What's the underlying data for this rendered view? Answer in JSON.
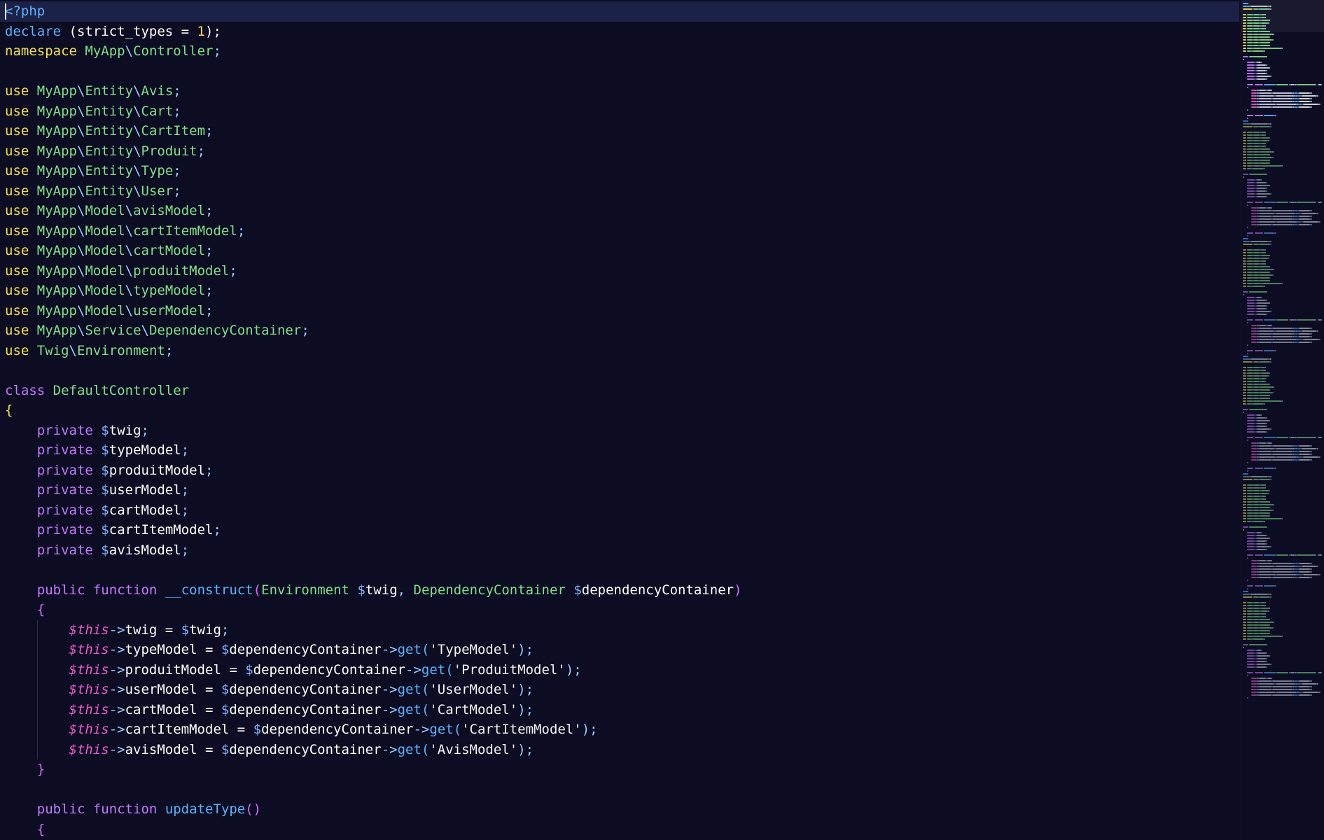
{
  "editor": {
    "current_line": 0,
    "colors": {
      "background": "#0c0c22",
      "current_line": "#1c2147",
      "keyword": "#f4e24a",
      "namespace": "#7fe08a",
      "modifier": "#c479ff",
      "variable": "#7fb2ff",
      "this": "#f05bcf",
      "function": "#5ab4ff"
    },
    "lines": [
      [
        {
          "t": "<?php",
          "c": "php"
        }
      ],
      [
        {
          "t": "declare",
          "c": "decl"
        },
        {
          "t": " (strict_types = ",
          "c": "name"
        },
        {
          "t": "1",
          "c": "num"
        },
        {
          "t": ");",
          "c": "name"
        }
      ],
      [
        {
          "t": "namespace",
          "c": "kw"
        },
        {
          "t": " ",
          "c": "name"
        },
        {
          "t": "MyApp",
          "c": "ns"
        },
        {
          "t": "\\",
          "c": "op"
        },
        {
          "t": "Controller",
          "c": "ns"
        },
        {
          "t": ";",
          "c": "op"
        }
      ],
      [],
      [
        {
          "t": "use",
          "c": "kw"
        },
        {
          "t": " ",
          "c": "name"
        },
        {
          "t": "MyApp",
          "c": "ns"
        },
        {
          "t": "\\",
          "c": "op"
        },
        {
          "t": "Entity",
          "c": "ns"
        },
        {
          "t": "\\",
          "c": "op"
        },
        {
          "t": "Avis",
          "c": "ns"
        },
        {
          "t": ";",
          "c": "op"
        }
      ],
      [
        {
          "t": "use",
          "c": "kw"
        },
        {
          "t": " ",
          "c": "name"
        },
        {
          "t": "MyApp",
          "c": "ns"
        },
        {
          "t": "\\",
          "c": "op"
        },
        {
          "t": "Entity",
          "c": "ns"
        },
        {
          "t": "\\",
          "c": "op"
        },
        {
          "t": "Cart",
          "c": "ns"
        },
        {
          "t": ";",
          "c": "op"
        }
      ],
      [
        {
          "t": "use",
          "c": "kw"
        },
        {
          "t": " ",
          "c": "name"
        },
        {
          "t": "MyApp",
          "c": "ns"
        },
        {
          "t": "\\",
          "c": "op"
        },
        {
          "t": "Entity",
          "c": "ns"
        },
        {
          "t": "\\",
          "c": "op"
        },
        {
          "t": "CartItem",
          "c": "ns"
        },
        {
          "t": ";",
          "c": "op"
        }
      ],
      [
        {
          "t": "use",
          "c": "kw"
        },
        {
          "t": " ",
          "c": "name"
        },
        {
          "t": "MyApp",
          "c": "ns"
        },
        {
          "t": "\\",
          "c": "op"
        },
        {
          "t": "Entity",
          "c": "ns"
        },
        {
          "t": "\\",
          "c": "op"
        },
        {
          "t": "Produit",
          "c": "ns"
        },
        {
          "t": ";",
          "c": "op"
        }
      ],
      [
        {
          "t": "use",
          "c": "kw"
        },
        {
          "t": " ",
          "c": "name"
        },
        {
          "t": "MyApp",
          "c": "ns"
        },
        {
          "t": "\\",
          "c": "op"
        },
        {
          "t": "Entity",
          "c": "ns"
        },
        {
          "t": "\\",
          "c": "op"
        },
        {
          "t": "Type",
          "c": "ns"
        },
        {
          "t": ";",
          "c": "op"
        }
      ],
      [
        {
          "t": "use",
          "c": "kw"
        },
        {
          "t": " ",
          "c": "name"
        },
        {
          "t": "MyApp",
          "c": "ns"
        },
        {
          "t": "\\",
          "c": "op"
        },
        {
          "t": "Entity",
          "c": "ns"
        },
        {
          "t": "\\",
          "c": "op"
        },
        {
          "t": "User",
          "c": "ns"
        },
        {
          "t": ";",
          "c": "op"
        }
      ],
      [
        {
          "t": "use",
          "c": "kw"
        },
        {
          "t": " ",
          "c": "name"
        },
        {
          "t": "MyApp",
          "c": "ns"
        },
        {
          "t": "\\",
          "c": "op"
        },
        {
          "t": "Model",
          "c": "ns"
        },
        {
          "t": "\\",
          "c": "op"
        },
        {
          "t": "avisModel",
          "c": "ns"
        },
        {
          "t": ";",
          "c": "op"
        }
      ],
      [
        {
          "t": "use",
          "c": "kw"
        },
        {
          "t": " ",
          "c": "name"
        },
        {
          "t": "MyApp",
          "c": "ns"
        },
        {
          "t": "\\",
          "c": "op"
        },
        {
          "t": "Model",
          "c": "ns"
        },
        {
          "t": "\\",
          "c": "op"
        },
        {
          "t": "cartItemModel",
          "c": "ns"
        },
        {
          "t": ";",
          "c": "op"
        }
      ],
      [
        {
          "t": "use",
          "c": "kw"
        },
        {
          "t": " ",
          "c": "name"
        },
        {
          "t": "MyApp",
          "c": "ns"
        },
        {
          "t": "\\",
          "c": "op"
        },
        {
          "t": "Model",
          "c": "ns"
        },
        {
          "t": "\\",
          "c": "op"
        },
        {
          "t": "cartModel",
          "c": "ns"
        },
        {
          "t": ";",
          "c": "op"
        }
      ],
      [
        {
          "t": "use",
          "c": "kw"
        },
        {
          "t": " ",
          "c": "name"
        },
        {
          "t": "MyApp",
          "c": "ns"
        },
        {
          "t": "\\",
          "c": "op"
        },
        {
          "t": "Model",
          "c": "ns"
        },
        {
          "t": "\\",
          "c": "op"
        },
        {
          "t": "produitModel",
          "c": "ns"
        },
        {
          "t": ";",
          "c": "op"
        }
      ],
      [
        {
          "t": "use",
          "c": "kw"
        },
        {
          "t": " ",
          "c": "name"
        },
        {
          "t": "MyApp",
          "c": "ns"
        },
        {
          "t": "\\",
          "c": "op"
        },
        {
          "t": "Model",
          "c": "ns"
        },
        {
          "t": "\\",
          "c": "op"
        },
        {
          "t": "typeModel",
          "c": "ns"
        },
        {
          "t": ";",
          "c": "op"
        }
      ],
      [
        {
          "t": "use",
          "c": "kw"
        },
        {
          "t": " ",
          "c": "name"
        },
        {
          "t": "MyApp",
          "c": "ns"
        },
        {
          "t": "\\",
          "c": "op"
        },
        {
          "t": "Model",
          "c": "ns"
        },
        {
          "t": "\\",
          "c": "op"
        },
        {
          "t": "userModel",
          "c": "ns"
        },
        {
          "t": ";",
          "c": "op"
        }
      ],
      [
        {
          "t": "use",
          "c": "kw"
        },
        {
          "t": " ",
          "c": "name"
        },
        {
          "t": "MyApp",
          "c": "ns"
        },
        {
          "t": "\\",
          "c": "op"
        },
        {
          "t": "Service",
          "c": "ns"
        },
        {
          "t": "\\",
          "c": "op"
        },
        {
          "t": "DependencyContainer",
          "c": "ns"
        },
        {
          "t": ";",
          "c": "op"
        }
      ],
      [
        {
          "t": "use",
          "c": "kw"
        },
        {
          "t": " ",
          "c": "name"
        },
        {
          "t": "Twig",
          "c": "ns"
        },
        {
          "t": "\\",
          "c": "op"
        },
        {
          "t": "Environment",
          "c": "ns"
        },
        {
          "t": ";",
          "c": "op"
        }
      ],
      [],
      [
        {
          "t": "class",
          "c": "mod"
        },
        {
          "t": " ",
          "c": "name"
        },
        {
          "t": "DefaultController",
          "c": "cls"
        }
      ],
      [
        {
          "t": "{",
          "c": "brace-y"
        }
      ],
      [
        {
          "t": "    ",
          "c": "name"
        },
        {
          "t": "private",
          "c": "mod"
        },
        {
          "t": " ",
          "c": "name"
        },
        {
          "t": "$",
          "c": "var"
        },
        {
          "t": "twig",
          "c": "name"
        },
        {
          "t": ";",
          "c": "op"
        }
      ],
      [
        {
          "t": "    ",
          "c": "name"
        },
        {
          "t": "private",
          "c": "mod"
        },
        {
          "t": " ",
          "c": "name"
        },
        {
          "t": "$",
          "c": "var"
        },
        {
          "t": "typeModel",
          "c": "name"
        },
        {
          "t": ";",
          "c": "op"
        }
      ],
      [
        {
          "t": "    ",
          "c": "name"
        },
        {
          "t": "private",
          "c": "mod"
        },
        {
          "t": " ",
          "c": "name"
        },
        {
          "t": "$",
          "c": "var"
        },
        {
          "t": "produitModel",
          "c": "name"
        },
        {
          "t": ";",
          "c": "op"
        }
      ],
      [
        {
          "t": "    ",
          "c": "name"
        },
        {
          "t": "private",
          "c": "mod"
        },
        {
          "t": " ",
          "c": "name"
        },
        {
          "t": "$",
          "c": "var"
        },
        {
          "t": "userModel",
          "c": "name"
        },
        {
          "t": ";",
          "c": "op"
        }
      ],
      [
        {
          "t": "    ",
          "c": "name"
        },
        {
          "t": "private",
          "c": "mod"
        },
        {
          "t": " ",
          "c": "name"
        },
        {
          "t": "$",
          "c": "var"
        },
        {
          "t": "cartModel",
          "c": "name"
        },
        {
          "t": ";",
          "c": "op"
        }
      ],
      [
        {
          "t": "    ",
          "c": "name"
        },
        {
          "t": "private",
          "c": "mod"
        },
        {
          "t": " ",
          "c": "name"
        },
        {
          "t": "$",
          "c": "var"
        },
        {
          "t": "cartItemModel",
          "c": "name"
        },
        {
          "t": ";",
          "c": "op"
        }
      ],
      [
        {
          "t": "    ",
          "c": "name"
        },
        {
          "t": "private",
          "c": "mod"
        },
        {
          "t": " ",
          "c": "name"
        },
        {
          "t": "$",
          "c": "var"
        },
        {
          "t": "avisModel",
          "c": "name"
        },
        {
          "t": ";",
          "c": "op"
        }
      ],
      [],
      [
        {
          "t": "    ",
          "c": "name"
        },
        {
          "t": "public",
          "c": "mod"
        },
        {
          "t": " ",
          "c": "name"
        },
        {
          "t": "function",
          "c": "mod"
        },
        {
          "t": " ",
          "c": "name"
        },
        {
          "t": "__construct",
          "c": "fn"
        },
        {
          "t": "(",
          "c": "brace-m"
        },
        {
          "t": "Environment",
          "c": "cls"
        },
        {
          "t": " ",
          "c": "name"
        },
        {
          "t": "$",
          "c": "var"
        },
        {
          "t": "twig",
          "c": "name"
        },
        {
          "t": ", ",
          "c": "op"
        },
        {
          "t": "DependencyContainer",
          "c": "cls"
        },
        {
          "t": " ",
          "c": "name"
        },
        {
          "t": "$",
          "c": "var"
        },
        {
          "t": "dependencyContainer",
          "c": "name"
        },
        {
          "t": ")",
          "c": "brace-m"
        }
      ],
      [
        {
          "t": "    ",
          "c": "name"
        },
        {
          "t": "{",
          "c": "brace-m"
        }
      ],
      [
        {
          "t": "        ",
          "c": "name"
        },
        {
          "t": "$this",
          "c": "this"
        },
        {
          "t": "->",
          "c": "op"
        },
        {
          "t": "twig = ",
          "c": "name"
        },
        {
          "t": "$",
          "c": "var"
        },
        {
          "t": "twig",
          "c": "name"
        },
        {
          "t": ";",
          "c": "op"
        }
      ],
      [
        {
          "t": "        ",
          "c": "name"
        },
        {
          "t": "$this",
          "c": "this"
        },
        {
          "t": "->",
          "c": "op"
        },
        {
          "t": "typeModel = ",
          "c": "name"
        },
        {
          "t": "$",
          "c": "var"
        },
        {
          "t": "dependencyContainer",
          "c": "name"
        },
        {
          "t": "->",
          "c": "op"
        },
        {
          "t": "get",
          "c": "fn"
        },
        {
          "t": "(",
          "c": "fn"
        },
        {
          "t": "'TypeModel'",
          "c": "str"
        },
        {
          "t": ");",
          "c": "op"
        }
      ],
      [
        {
          "t": "        ",
          "c": "name"
        },
        {
          "t": "$this",
          "c": "this"
        },
        {
          "t": "->",
          "c": "op"
        },
        {
          "t": "produitModel = ",
          "c": "name"
        },
        {
          "t": "$",
          "c": "var"
        },
        {
          "t": "dependencyContainer",
          "c": "name"
        },
        {
          "t": "->",
          "c": "op"
        },
        {
          "t": "get",
          "c": "fn"
        },
        {
          "t": "(",
          "c": "fn"
        },
        {
          "t": "'ProduitModel'",
          "c": "str"
        },
        {
          "t": ");",
          "c": "op"
        }
      ],
      [
        {
          "t": "        ",
          "c": "name"
        },
        {
          "t": "$this",
          "c": "this"
        },
        {
          "t": "->",
          "c": "op"
        },
        {
          "t": "userModel = ",
          "c": "name"
        },
        {
          "t": "$",
          "c": "var"
        },
        {
          "t": "dependencyContainer",
          "c": "name"
        },
        {
          "t": "->",
          "c": "op"
        },
        {
          "t": "get",
          "c": "fn"
        },
        {
          "t": "(",
          "c": "fn"
        },
        {
          "t": "'UserModel'",
          "c": "str"
        },
        {
          "t": ");",
          "c": "op"
        }
      ],
      [
        {
          "t": "        ",
          "c": "name"
        },
        {
          "t": "$this",
          "c": "this"
        },
        {
          "t": "->",
          "c": "op"
        },
        {
          "t": "cartModel = ",
          "c": "name"
        },
        {
          "t": "$",
          "c": "var"
        },
        {
          "t": "dependencyContainer",
          "c": "name"
        },
        {
          "t": "->",
          "c": "op"
        },
        {
          "t": "get",
          "c": "fn"
        },
        {
          "t": "(",
          "c": "fn"
        },
        {
          "t": "'CartModel'",
          "c": "str"
        },
        {
          "t": ");",
          "c": "op"
        }
      ],
      [
        {
          "t": "        ",
          "c": "name"
        },
        {
          "t": "$this",
          "c": "this"
        },
        {
          "t": "->",
          "c": "op"
        },
        {
          "t": "cartItemModel = ",
          "c": "name"
        },
        {
          "t": "$",
          "c": "var"
        },
        {
          "t": "dependencyContainer",
          "c": "name"
        },
        {
          "t": "->",
          "c": "op"
        },
        {
          "t": "get",
          "c": "fn"
        },
        {
          "t": "(",
          "c": "fn"
        },
        {
          "t": "'CartItemModel'",
          "c": "str"
        },
        {
          "t": ");",
          "c": "op"
        }
      ],
      [
        {
          "t": "        ",
          "c": "name"
        },
        {
          "t": "$this",
          "c": "this"
        },
        {
          "t": "->",
          "c": "op"
        },
        {
          "t": "avisModel = ",
          "c": "name"
        },
        {
          "t": "$",
          "c": "var"
        },
        {
          "t": "dependencyContainer",
          "c": "name"
        },
        {
          "t": "->",
          "c": "op"
        },
        {
          "t": "get",
          "c": "fn"
        },
        {
          "t": "(",
          "c": "fn"
        },
        {
          "t": "'AvisModel'",
          "c": "str"
        },
        {
          "t": ");",
          "c": "op"
        }
      ],
      [
        {
          "t": "    ",
          "c": "name"
        },
        {
          "t": "}",
          "c": "brace-m"
        }
      ],
      [],
      [
        {
          "t": "    ",
          "c": "name"
        },
        {
          "t": "public",
          "c": "mod"
        },
        {
          "t": " ",
          "c": "name"
        },
        {
          "t": "function",
          "c": "mod"
        },
        {
          "t": " ",
          "c": "name"
        },
        {
          "t": "updateType",
          "c": "fn"
        },
        {
          "t": "()",
          "c": "brace-m"
        }
      ],
      [
        {
          "t": "    ",
          "c": "name"
        },
        {
          "t": "{",
          "c": "brace-m"
        }
      ]
    ]
  }
}
